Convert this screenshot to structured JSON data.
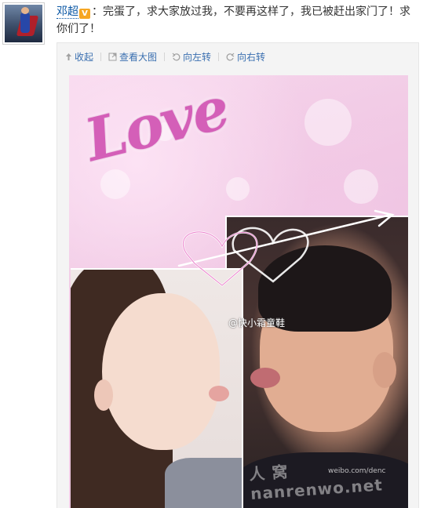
{
  "post": {
    "username": "邓超",
    "verified_badge": "V",
    "text": "：完蛋了，求大家放过我，不要再这样了，我已被赶出家门了！求你们了！"
  },
  "toolbar": {
    "collapse": {
      "icon": "arrow-up-icon",
      "label": "收起"
    },
    "view_large": {
      "icon": "expand-image-icon",
      "label": "查看大图"
    },
    "rotate_left": {
      "icon": "rotate-left-icon",
      "label": "向左转"
    },
    "rotate_right": {
      "icon": "rotate-right-icon",
      "label": "向右转"
    }
  },
  "image": {
    "overlay_text": "Love",
    "watermark_handle": "@快小霜童鞋",
    "watermark_site": "人 窝 nanrenwo.net",
    "watermark_url": "weibo.com/denc"
  },
  "colors": {
    "link": "#0a57a4",
    "toolbar_link": "#3a6fb0",
    "badge": "#f6a623",
    "love": "#d45fb8"
  }
}
